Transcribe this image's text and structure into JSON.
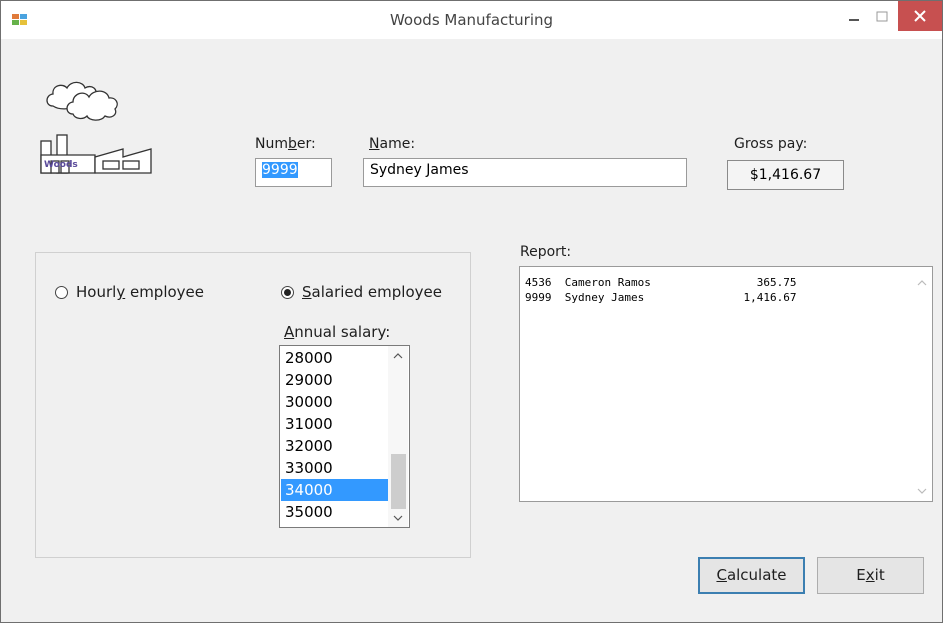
{
  "window": {
    "title": "Woods Manufacturing"
  },
  "logo": {
    "text": "Woods"
  },
  "number": {
    "label_pre": "Num",
    "label_key": "b",
    "label_post": "er:",
    "value": "9999"
  },
  "name": {
    "label_key": "N",
    "label_post": "ame:",
    "value": "Sydney James"
  },
  "gross_pay": {
    "label": "Gross pay:",
    "value": "$1,416.67"
  },
  "employee_type": {
    "hourly": {
      "pre": "Hourl",
      "key": "y",
      "post": " employee",
      "selected": false
    },
    "salaried": {
      "pre": "",
      "key": "S",
      "post": "alaried employee",
      "selected": true
    }
  },
  "annual_salary": {
    "label_key": "A",
    "label_post": "nnual salary:",
    "items": [
      "28000",
      "29000",
      "30000",
      "31000",
      "32000",
      "33000",
      "34000",
      "35000"
    ],
    "selected": "34000"
  },
  "report": {
    "label": "Report:",
    "lines": [
      "4536  Cameron Ramos                365.75",
      "9999  Sydney James               1,416.67"
    ]
  },
  "buttons": {
    "calculate": {
      "key": "C",
      "post": "alculate"
    },
    "exit": {
      "pre": "E",
      "key": "x",
      "post": "it"
    }
  },
  "colors": {
    "selection": "#3399ff",
    "close_button": "#c75050",
    "default_button_border": "#3c7fb1"
  }
}
